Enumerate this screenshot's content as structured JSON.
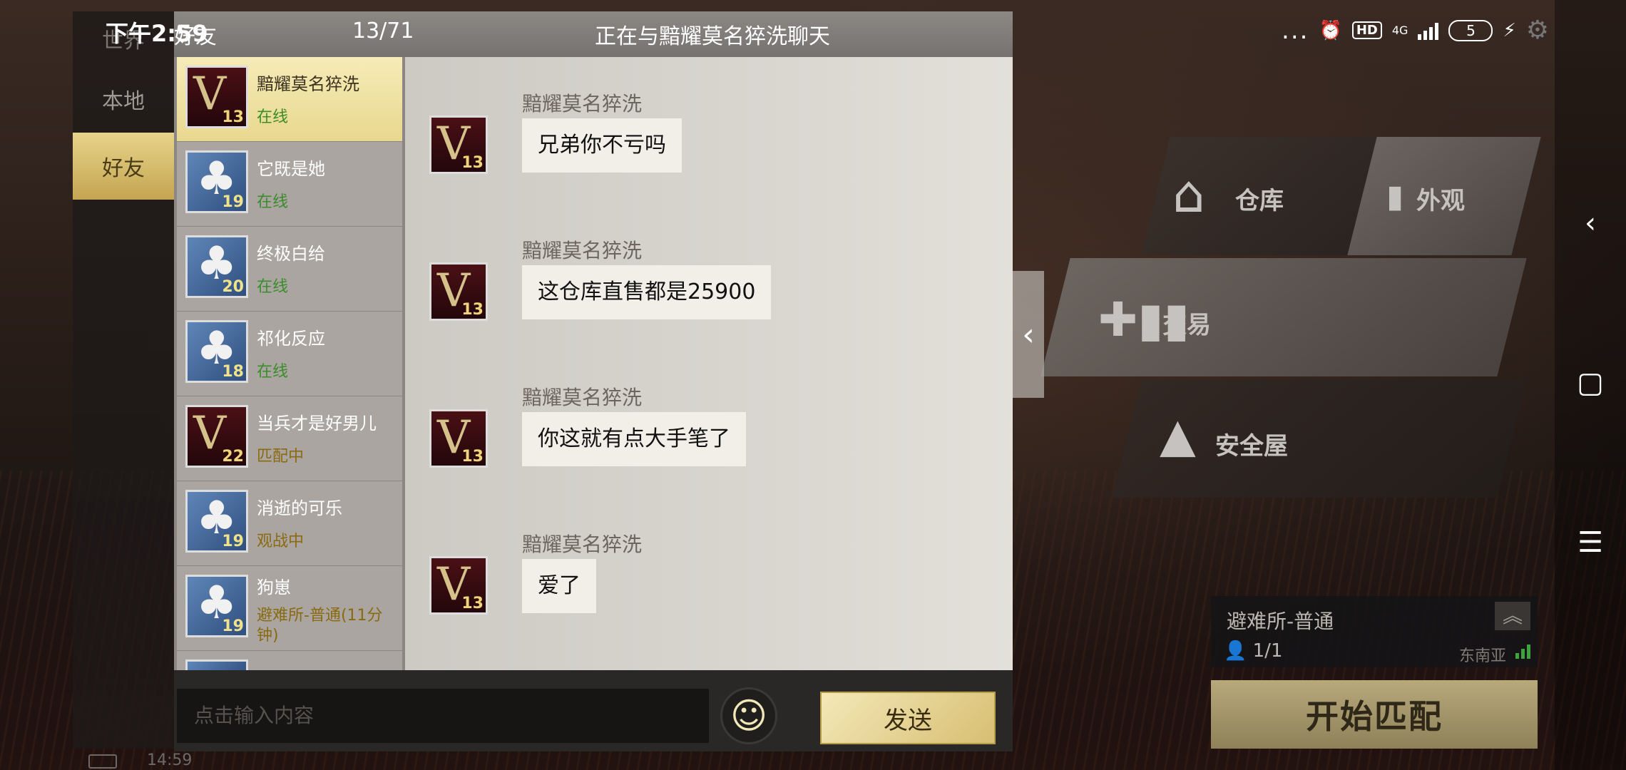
{
  "status_bar": {
    "time": "下午2:59",
    "dots": "...",
    "hd": "HD",
    "network": "4G",
    "battery": "5"
  },
  "left_nav": {
    "items": [
      {
        "label": "世界"
      },
      {
        "label": "本地"
      },
      {
        "label": "好友"
      }
    ]
  },
  "chat_header": {
    "left_label": "好友",
    "count": "13/71",
    "title": "正在与黯耀莫名猝洗聊天"
  },
  "friends": [
    {
      "name": "黯耀莫名猝洗",
      "status": "在线",
      "level": "13",
      "avatar_icon": "v-rank-icon"
    },
    {
      "name": "它既是她",
      "status": "在线",
      "level": "19",
      "avatar_icon": "club-icon"
    },
    {
      "name": "终极白给",
      "status": "在线",
      "level": "20",
      "avatar_icon": "club-icon"
    },
    {
      "name": "祁化反应",
      "status": "在线",
      "level": "18",
      "avatar_icon": "club-icon"
    },
    {
      "name": "当兵才是好男儿",
      "status": "匹配中",
      "level": "22",
      "avatar_icon": "v-rank-icon"
    },
    {
      "name": "消逝的可乐",
      "status": "观战中",
      "level": "19",
      "avatar_icon": "club-icon"
    },
    {
      "name": "狗崽",
      "status": "避难所-普通(11分钟)",
      "level": "19",
      "avatar_icon": "club-icon"
    }
  ],
  "messages": [
    {
      "sender": "黯耀莫名猝洗",
      "text": "兄弟你不亏吗",
      "level": "13"
    },
    {
      "sender": "黯耀莫名猝洗",
      "text": "这仓库直售都是25900",
      "level": "13"
    },
    {
      "sender": "黯耀莫名猝洗",
      "text": "你这就有点大手笔了",
      "level": "13"
    },
    {
      "sender": "黯耀莫名猝洗",
      "text": "爱了",
      "level": "13"
    }
  ],
  "input": {
    "placeholder": "点击输入内容",
    "send_label": "发送"
  },
  "game_menu": {
    "warehouse": "仓库",
    "appearance": "外观",
    "trade": "交易",
    "safehouse": "安全屋"
  },
  "mode": {
    "name": "避难所-普通",
    "players": "1/1",
    "region": "东南亚",
    "start_label": "开始匹配"
  },
  "bottom_clock": "14:59",
  "colors": {
    "accent_gold": "#e7d38a",
    "online_green": "#3b8c2a",
    "status_gold": "#8a6a10"
  }
}
